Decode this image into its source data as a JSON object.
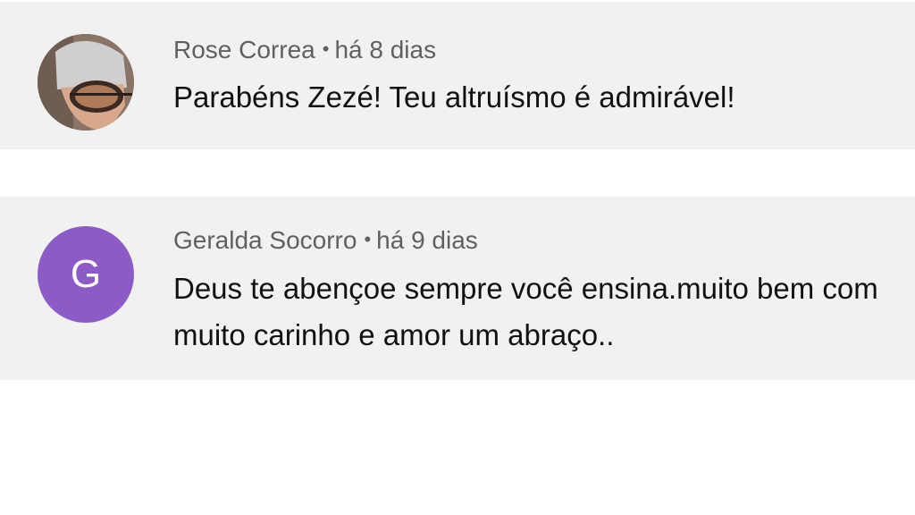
{
  "comments": [
    {
      "author": "Rose Correa",
      "separator": "•",
      "time": "há 8 dias",
      "text": "Parabéns Zezé! Teu altruísmo é admirável!",
      "avatar": {
        "type": "photo"
      }
    },
    {
      "author": "Geralda Socorro",
      "separator": "•",
      "time": "há 9 dias",
      "text": "Deus te abençoe  sempre você ensina.muito bem com muito carinho e amor um abraço..",
      "avatar": {
        "type": "letter",
        "letter": "G",
        "color": "#8b5cc8"
      }
    }
  ]
}
